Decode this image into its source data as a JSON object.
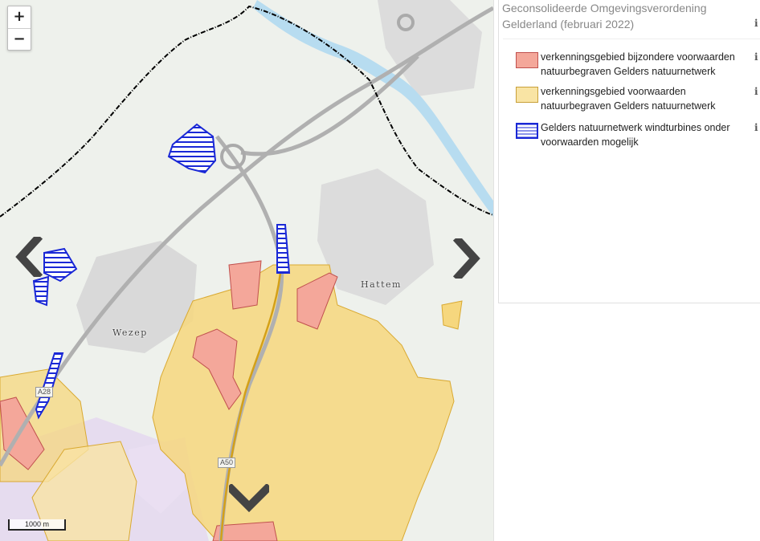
{
  "map": {
    "places": [
      "Hattem",
      "Wezep"
    ],
    "roads": [
      "A28",
      "A50"
    ],
    "scale_label": "1000 m",
    "zoom_in": "+",
    "zoom_out": "−",
    "colors": {
      "background": "#eef1ec",
      "urban": "#d9d9d9",
      "water": "#b7dcf0",
      "orange_zone": "#f4a79a",
      "yellow_zone": "#f6d77e",
      "lilac_zone": "#e6dcef",
      "hatched_zone": "#1a28d6",
      "boundary": "#000000"
    }
  },
  "panel": {
    "title": "Geconsolideerde Omgevingsverordening Gelderland (februari 2022)",
    "info_icon": "i",
    "legend": [
      {
        "label": "verkenningsgebied bijzondere voorwaarden natuurbegraven Gelders natuurnetwerk",
        "color": "#f4a79a",
        "border": "#c0504d",
        "pattern": "solid",
        "info": "i"
      },
      {
        "label": "verkenningsgebied voorwaarden natuurbegraven Gelders natuurnetwerk",
        "color": "#f9e4a4",
        "border": "#c8a03a",
        "pattern": "solid",
        "info": "i"
      },
      {
        "label": "Gelders natuurnetwerk windturbines onder voorwaarden mogelijk",
        "color": "#ffffff",
        "border": "#1a28d6",
        "pattern": "hatched",
        "info": "i"
      }
    ]
  }
}
